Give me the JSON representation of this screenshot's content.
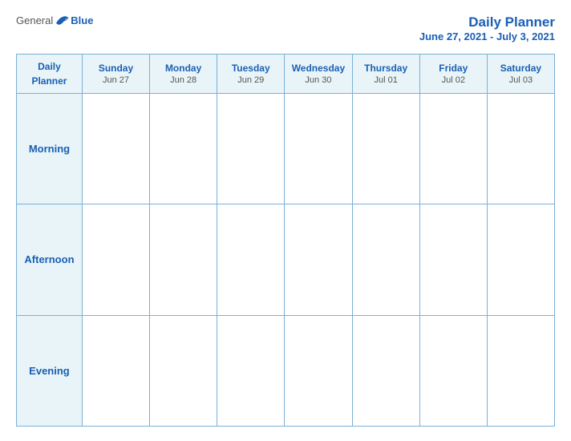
{
  "header": {
    "logo": {
      "general": "General",
      "blue": "Blue"
    },
    "title": "Daily Planner",
    "date_range": "June 27, 2021 - July 3, 2021"
  },
  "calendar": {
    "header_label": "Daily Planner",
    "columns": [
      {
        "day": "Sunday",
        "date": "Jun 27"
      },
      {
        "day": "Monday",
        "date": "Jun 28"
      },
      {
        "day": "Tuesday",
        "date": "Jun 29"
      },
      {
        "day": "Wednesday",
        "date": "Jun 30"
      },
      {
        "day": "Thursday",
        "date": "Jul 01"
      },
      {
        "day": "Friday",
        "date": "Jul 02"
      },
      {
        "day": "Saturday",
        "date": "Jul 03"
      }
    ],
    "rows": [
      {
        "label": "Morning"
      },
      {
        "label": "Afternoon"
      },
      {
        "label": "Evening"
      }
    ]
  }
}
